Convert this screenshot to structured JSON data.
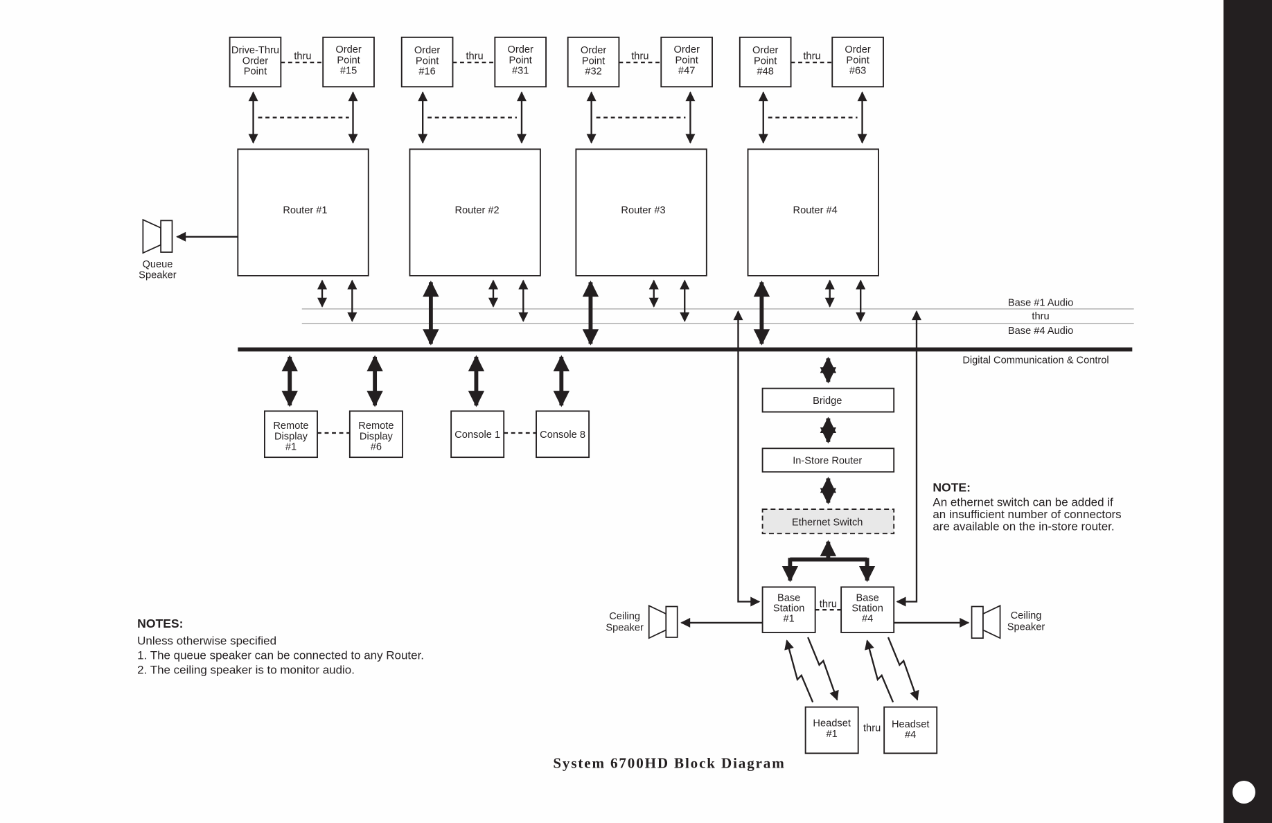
{
  "diagram": {
    "title": "System 6700HD Block Diagram",
    "order_points": [
      {
        "lines": [
          "Drive-Thru",
          "Order",
          "Point"
        ]
      },
      {
        "lines": [
          "Order",
          "Point",
          "#15"
        ]
      },
      {
        "lines": [
          "Order",
          "Point",
          "#16"
        ]
      },
      {
        "lines": [
          "Order",
          "Point",
          "#31"
        ]
      },
      {
        "lines": [
          "Order",
          "Point",
          "#32"
        ]
      },
      {
        "lines": [
          "Order",
          "Point",
          "#47"
        ]
      },
      {
        "lines": [
          "Order",
          "Point",
          "#48"
        ]
      },
      {
        "lines": [
          "Order",
          "Point",
          "#63"
        ]
      }
    ],
    "thru_label": "thru",
    "routers": [
      "Router #1",
      "Router #2",
      "Router #3",
      "Router #4"
    ],
    "queue_speaker": [
      "Queue",
      "Speaker"
    ],
    "buses": {
      "audio_top": "Base #1 Audio",
      "audio_thru": "thru",
      "audio_bottom": "Base #4 Audio",
      "digital": "Digital  Communication  &  Control"
    },
    "remote_displays": [
      {
        "lines": [
          "Remote",
          "Display",
          "#1"
        ]
      },
      {
        "lines": [
          "Remote",
          "Display",
          "#6"
        ]
      }
    ],
    "consoles": [
      "Console 1",
      "Console 8"
    ],
    "bridge": "Bridge",
    "in_store_router": "In-Store Router",
    "ethernet_switch": "Ethernet Switch",
    "base_stations": [
      {
        "lines": [
          "Base",
          "Station",
          "#1"
        ]
      },
      {
        "lines": [
          "Base",
          "Station",
          "#4"
        ]
      }
    ],
    "ceiling_speaker": [
      "Ceiling",
      "Speaker"
    ],
    "headsets": [
      {
        "lines": [
          "Headset",
          "#1"
        ]
      },
      {
        "lines": [
          "Headset",
          "#4"
        ]
      }
    ],
    "note": {
      "heading": "NOTE:",
      "lines": [
        "An ethernet switch can be added if",
        "an insufficient number of connectors",
        "are available on the in-store router."
      ]
    },
    "notes": {
      "heading": "NOTES:",
      "lines": [
        "Unless otherwise specified",
        "1.  The queue speaker can be connected to any Router.",
        "2.  The ceiling speaker is to monitor audio."
      ]
    }
  }
}
